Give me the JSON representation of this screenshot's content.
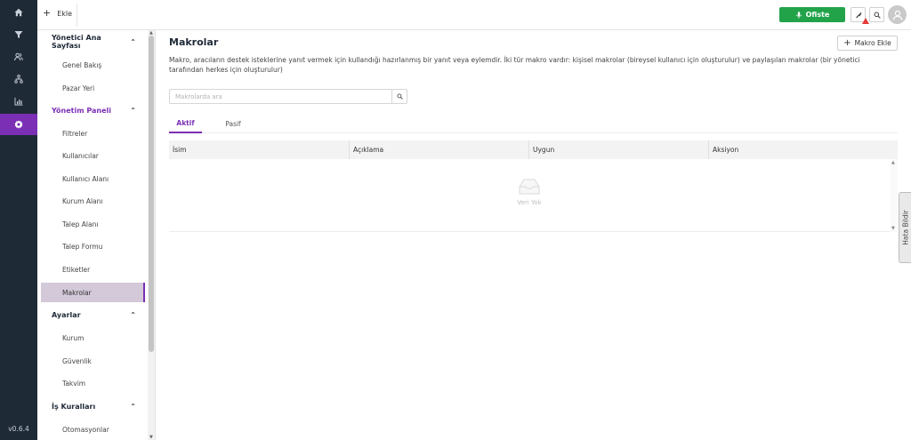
{
  "rail": {
    "icons": [
      "home-icon",
      "funnel-icon",
      "users-icon",
      "hierarchy-icon",
      "chart-icon",
      "gear-icon"
    ],
    "active": "gear-icon",
    "version": "v0.6.4"
  },
  "topbar": {
    "add_label": "Ekle",
    "status_label": "Ofiste",
    "status_color": "#22a34a"
  },
  "menu": {
    "sections": [
      {
        "label": "Yönetici Ana Sayfası",
        "items": [
          "Genel Bakış",
          "Pazar Yeri"
        ]
      },
      {
        "label": "Yönetim Paneli",
        "items": [
          "Filtreler",
          "Kullanıcılar",
          "Kullanıcı Alanı",
          "Kurum Alanı",
          "Talep Alanı",
          "Talep Formu",
          "Etiketler",
          "Makrolar"
        ]
      },
      {
        "label": "Ayarlar",
        "items": [
          "Kurum",
          "Güvenlik",
          "Takvim"
        ]
      },
      {
        "label": "İş Kuralları",
        "items": [
          "Otomasyonlar"
        ]
      }
    ],
    "selected": "Makrolar",
    "accent": "#7b2fb5"
  },
  "main": {
    "title": "Makrolar",
    "new_button": "Makro Ekle",
    "description": "Makro, aracıların destek isteklerine yanıt vermek için kullandığı hazırlanmış bir yanıt veya eylemdir. İki tür makro vardır: kişisel makrolar (bireysel kullanıcı için oluşturulur) ve paylaşılan makrolar (bir yönetici tarafından herkes için oluşturulur)",
    "search_placeholder": "Makrolarda ara",
    "tabs": [
      "Aktif",
      "Pasif"
    ],
    "active_tab": "Aktif",
    "columns": [
      "İsim",
      "Açıklama",
      "Uygun",
      "Aksiyon"
    ],
    "empty_text": "Veri Yok"
  },
  "feedback_tab": "Hata Bildir"
}
